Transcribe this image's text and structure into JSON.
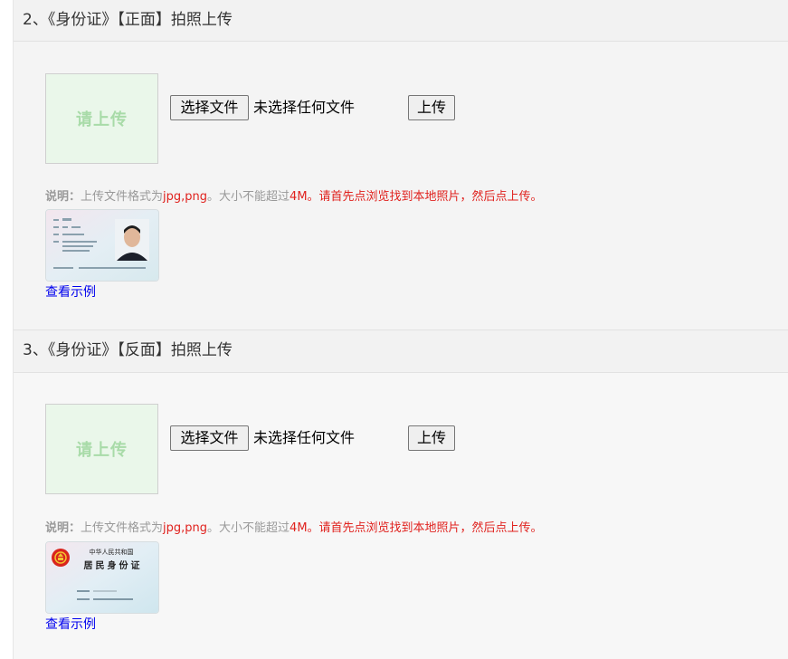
{
  "sections": [
    {
      "title": "2、《身份证》【正面】拍照上传",
      "preview_text": "请上传",
      "choose_file_label": "选择文件",
      "no_file_text": "未选择任何文件",
      "upload_label": "上传",
      "note": {
        "label": "说明：",
        "text_1": "上传文件格式为",
        "formats": "jpg,png",
        "text_2": "。大小不能超过",
        "size": "4M",
        "text_3": "。请首先点浏览找到本地照片，然后点上传。"
      },
      "sample_link": "查看示例"
    },
    {
      "title": "3、《身份证》【反面】拍照上传",
      "preview_text": "请上传",
      "choose_file_label": "选择文件",
      "no_file_text": "未选择任何文件",
      "upload_label": "上传",
      "note": {
        "label": "说明：",
        "text_1": "上传文件格式为",
        "formats": "jpg,png",
        "text_2": "。大小不能超过",
        "size": "4M",
        "text_3": "。请首先点浏览找到本地照片，然后点上传。"
      },
      "sample_link": "查看示例",
      "sample_card_text": {
        "country": "中华人民共和国",
        "card_name": "居民身份证"
      }
    }
  ]
}
